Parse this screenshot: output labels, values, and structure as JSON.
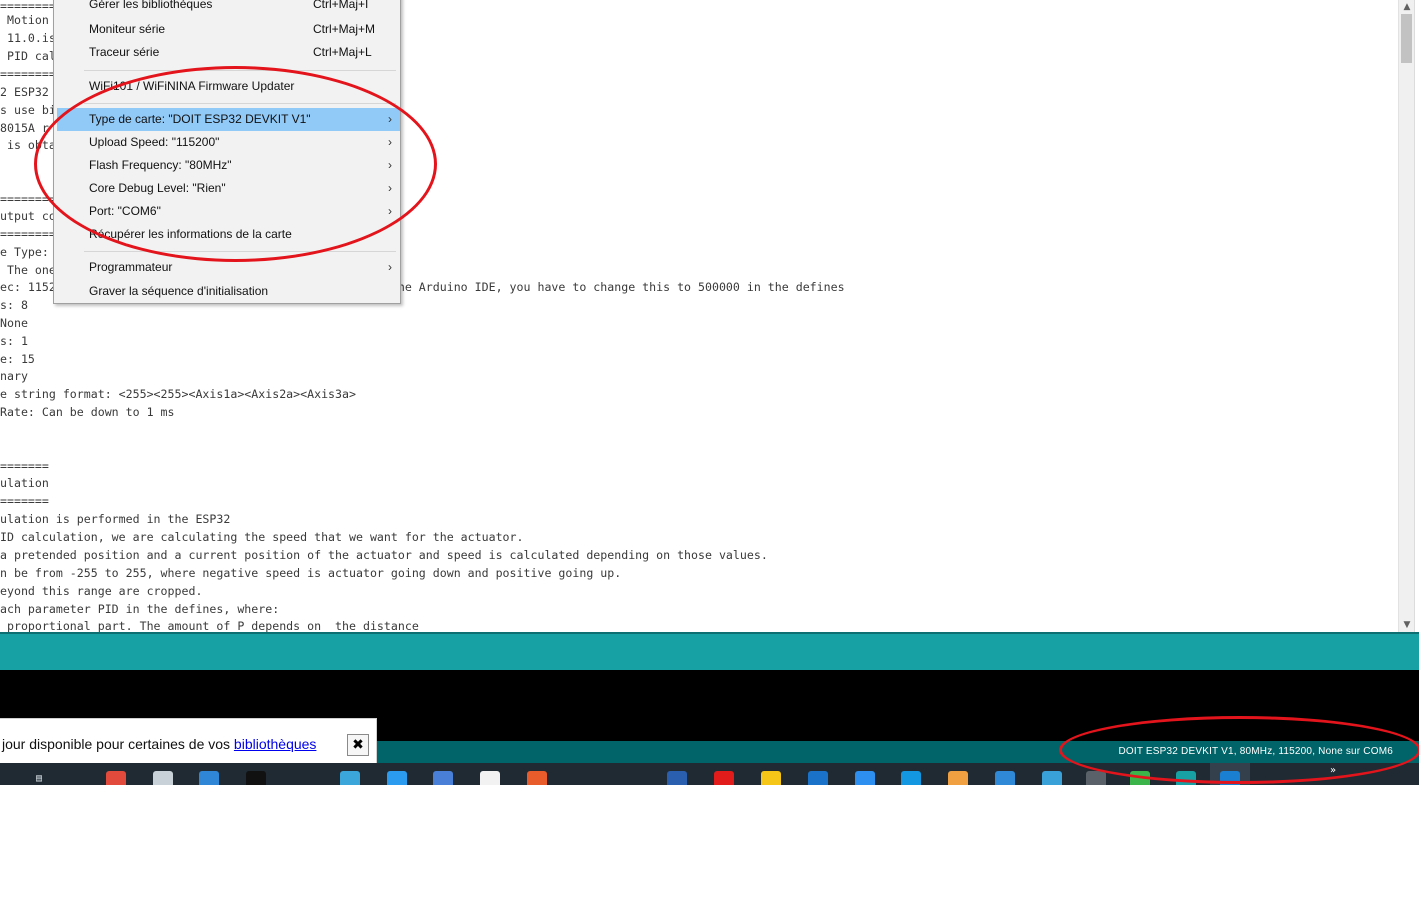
{
  "editor": {
    "lines": [
      "=========",
      " Motion",
      " 11.0.is",
      " PID cal",
      "=========",
      "2 ESP32",
      "s use bi",
      "8015A r",
      " is obta",
      "",
      "",
      "=========",
      "utput co",
      "=========",
      "e Type:",
      " The one",
      "ec: 1152                                           r of the Arduino IDE, you have to change this to 500000 in the defines",
      "s: 8",
      "None",
      "s: 1",
      "e: 15",
      "nary",
      "e string format: <255><255><Axis1a><Axis2a><Axis3a>",
      "Rate: Can be down to 1 ms",
      "",
      "",
      "=======",
      "ulation",
      "=======",
      "ulation is performed in the ESP32",
      "ID calculation, we are calculating the speed that we want for the actuator.",
      "a pretended position and a current position of the actuator and speed is calculated depending on those values.",
      "n be from -255 to 255, where negative speed is actuator going down and positive going up.",
      "eyond this range are cropped.",
      "ach parameter PID in the defines, where:",
      " proportional part. The amount of P depends on  the distance"
    ]
  },
  "menu": {
    "items": [
      {
        "label": "Gérer les bibliothèques",
        "shortcut": "Ctrl+Maj+I"
      },
      {
        "label": "Moniteur série",
        "shortcut": "Ctrl+Maj+M"
      },
      {
        "label": "Traceur série",
        "shortcut": "Ctrl+Maj+L"
      },
      {
        "label": "WiFi101 / WiFiNINA Firmware Updater",
        "shortcut": ""
      },
      {
        "label": "Type de carte: \"DOIT ESP32 DEVKIT V1\"",
        "shortcut": "",
        "submenu": true,
        "highlighted": true
      },
      {
        "label": "Upload Speed: \"115200\"",
        "shortcut": "",
        "submenu": true
      },
      {
        "label": "Flash Frequency: \"80MHz\"",
        "shortcut": "",
        "submenu": true
      },
      {
        "label": "Core Debug Level: \"Rien\"",
        "shortcut": "",
        "submenu": true
      },
      {
        "label": "Port: \"COM6\"",
        "shortcut": "",
        "submenu": true
      },
      {
        "label": "Récupérer les informations de la carte",
        "shortcut": ""
      },
      {
        "label": "Programmateur",
        "shortcut": "",
        "submenu": true
      },
      {
        "label": "Graver la séquence d'initialisation",
        "shortcut": ""
      }
    ],
    "submenu_arrow": "›"
  },
  "status_bar": {
    "board_info": "DOIT ESP32 DEVKIT V1, 80MHz, 115200, None sur COM6"
  },
  "notification": {
    "text": "jour disponible pour certaines de vos ",
    "link": "bibliothèques",
    "close": "✖"
  },
  "scrollbar": {
    "up": "▲",
    "down": "▼"
  },
  "taskbar": {
    "search_glyph": "▤",
    "overflow": "»",
    "icons": [
      {
        "name": "chrome-icon",
        "color": "#e24a3b"
      },
      {
        "name": "printer-icon",
        "color": "#c9d1d8"
      },
      {
        "name": "mail-icon",
        "color": "#2f86d6"
      },
      {
        "name": "netflix-icon",
        "color": "#111111"
      },
      {
        "name": "prime-video-icon",
        "color": "#1f2a33"
      },
      {
        "name": "whatsapp-icon",
        "color": "#3aa6d9"
      },
      {
        "name": "twitter-icon",
        "color": "#2b9bf0"
      },
      {
        "name": "docs-icon",
        "color": "#4a7fd8"
      },
      {
        "name": "amazon-icon",
        "color": "#f2f2f2"
      },
      {
        "name": "app-orange-icon",
        "color": "#e85b2a"
      },
      {
        "name": "app-green-hex-icon",
        "color": "#1f2a33"
      },
      {
        "name": "app-green-hex-2-icon",
        "color": "#1f2a33"
      },
      {
        "name": "app-blue-square-icon",
        "color": "#2a5fb0"
      },
      {
        "name": "youtube-icon",
        "color": "#e21b1b"
      },
      {
        "name": "app-yellow-icon",
        "color": "#f5c518"
      },
      {
        "name": "app-window-icon",
        "color": "#1a73c8"
      },
      {
        "name": "app-circle-blue-icon",
        "color": "#2d8ff0"
      },
      {
        "name": "app-s-icon",
        "color": "#1297e0"
      },
      {
        "name": "app-orange-2-icon",
        "color": "#f0a040"
      },
      {
        "name": "edge-icon",
        "color": "#2f89d6"
      },
      {
        "name": "app-store-icon",
        "color": "#3aa0d8"
      },
      {
        "name": "app-gray-icon",
        "color": "#5a6168"
      },
      {
        "name": "app-green-circle-icon",
        "color": "#3bb54a"
      },
      {
        "name": "arduino-icon",
        "color": "#17a1a5"
      },
      {
        "name": "app-active-blue-icon",
        "color": "#1a7fd0"
      }
    ]
  },
  "annotation_color": "#e3141b"
}
